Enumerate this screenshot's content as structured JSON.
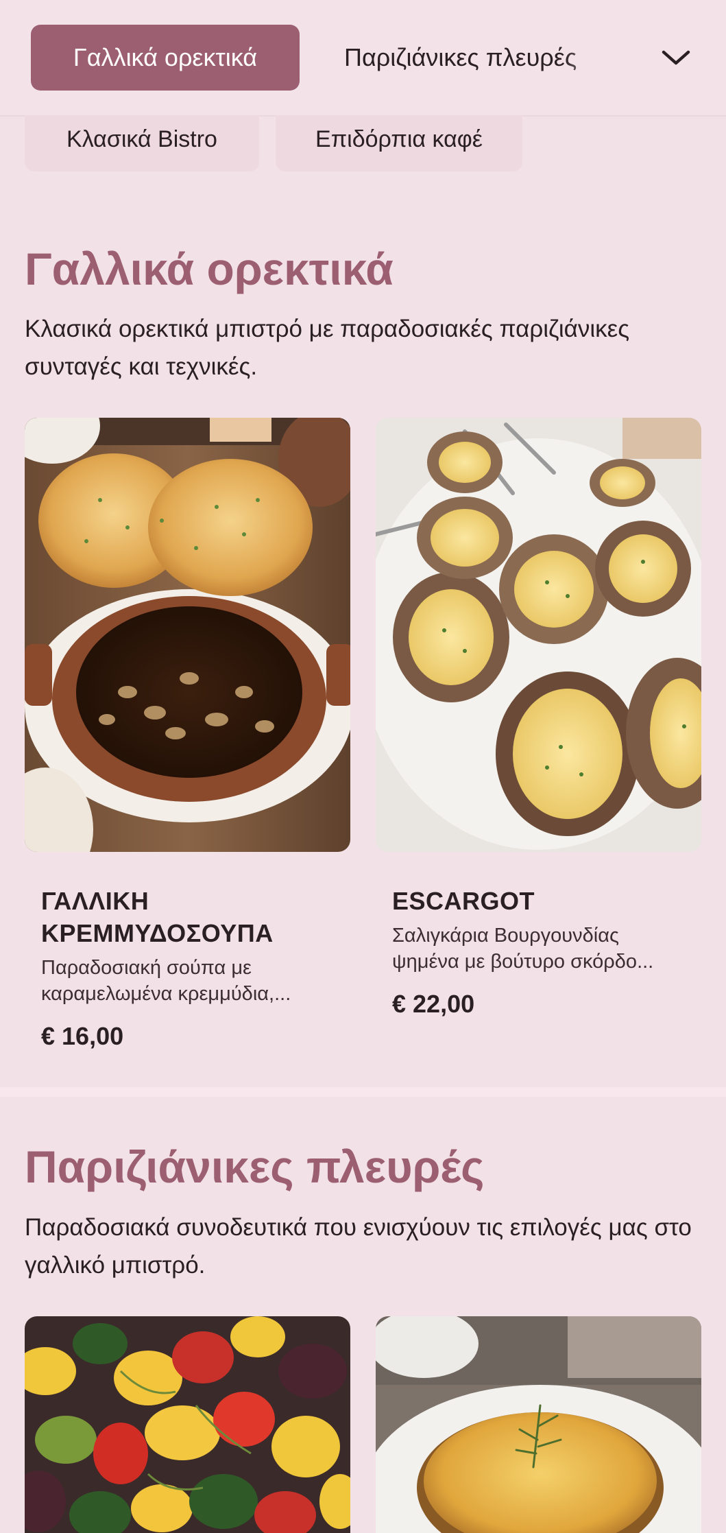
{
  "tabs": {
    "active": "Γαλλικά ορεκτικά",
    "next": "Παριζιάνικες πλευρές",
    "expand_icon": "chevron-down-icon",
    "pills": [
      "Κλασικά Bistro",
      "Επιδόρπια καφέ"
    ]
  },
  "sections": [
    {
      "title": "Γαλλικά ορεκτικά",
      "description": "Κλασικά ορεκτικά μπιστρό με παραδοσιακές παριζιάνικες συνταγές και τεχνικές.",
      "items": [
        {
          "name": "ΓΑΛΛΙΚΗ ΚΡΕΜΜΥΔΟΣΟΥΠΑ",
          "description": "Παραδοσιακή σούπα με καραμελωμένα κρεμμύδια,...",
          "price": "€ 16,00"
        },
        {
          "name": "ESCARGOT",
          "description": "Σαλιγκάρια Βουργουνδίας ψημένα με βούτυρο σκόρδο...",
          "price": "€ 22,00"
        }
      ]
    },
    {
      "title": "Παριζιάνικες πλευρές",
      "description": "Παραδοσιακά συνοδευτικά που ενισχύουν τις επιλογές μας στο γαλλικό μπιστρό."
    }
  ],
  "colors": {
    "accent": "#9c5f72",
    "background": "#f3e1e8"
  }
}
